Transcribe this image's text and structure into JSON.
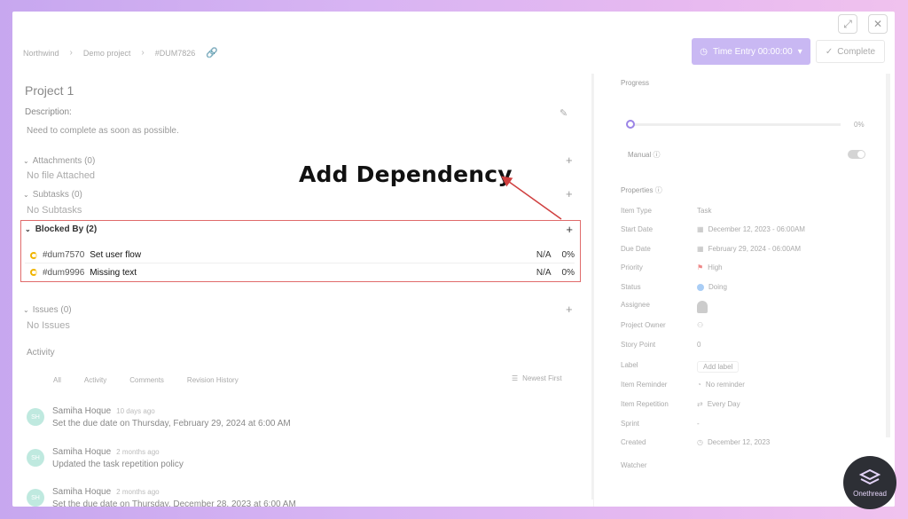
{
  "window": {
    "maximize_glyph": "⤢",
    "close_glyph": "✕"
  },
  "breadcrumb": [
    "Northwind",
    "Demo project",
    "#DUM7826"
  ],
  "header": {
    "time_entry": "Time Entry 00:00:00",
    "complete": "Complete"
  },
  "task": {
    "title": "Project 1",
    "description_label": "Description:",
    "description": "Need to complete as soon as possible."
  },
  "sections": {
    "attachments": {
      "label": "Attachments (0)",
      "empty": "No file Attached"
    },
    "subtasks": {
      "label": "Subtasks (0)",
      "empty": "No Subtasks"
    },
    "blocked_by": {
      "label": "Blocked By (2)",
      "items": [
        {
          "id": "#dum7570",
          "title": "Set user flow",
          "value": "N/A",
          "percent": "0%"
        },
        {
          "id": "#dum9996",
          "title": "Missing text",
          "value": "N/A",
          "percent": "0%"
        }
      ]
    },
    "issues": {
      "label": "Issues (0)",
      "empty": "No Issues"
    }
  },
  "activity": {
    "title": "Activity",
    "tabs": [
      "All",
      "Activity",
      "Comments",
      "Revision History"
    ],
    "sort": "Newest First",
    "items": [
      {
        "user": "Samiha Hoque",
        "time": "10 days ago",
        "text": "Set the due date on Thursday, February 29, 2024 at 6:00 AM"
      },
      {
        "user": "Samiha Hoque",
        "time": "2 months ago",
        "text": "Updated the task repetition policy"
      },
      {
        "user": "Samiha Hoque",
        "time": "2 months ago",
        "text": "Set the due date on Thursday, December 28, 2023 at 6:00 AM"
      }
    ]
  },
  "progress": {
    "label": "Progress",
    "value": "0%",
    "manual_label": "Manual"
  },
  "properties": {
    "label": "Properties",
    "rows": [
      {
        "key": "Item Type",
        "value": "Task"
      },
      {
        "key": "Start Date",
        "value": "December 12, 2023 - 06:00AM"
      },
      {
        "key": "Due Date",
        "value": "February 29, 2024 - 06:00AM"
      },
      {
        "key": "Priority",
        "value": "High"
      },
      {
        "key": "Status",
        "value": "Doing"
      },
      {
        "key": "Assignee",
        "value": ""
      },
      {
        "key": "Project Owner",
        "value": ""
      },
      {
        "key": "Story Point",
        "value": "0"
      },
      {
        "key": "Label",
        "value": "Add label"
      },
      {
        "key": "Item Reminder",
        "value": "No reminder"
      },
      {
        "key": "Item Repetition",
        "value": "Every Day"
      },
      {
        "key": "Sprint",
        "value": "-"
      },
      {
        "key": "Created",
        "value": "December 12, 2023"
      },
      {
        "key": "Watcher",
        "value": ""
      }
    ]
  },
  "annotation": {
    "text": "Add Dependency",
    "color": "#d04040",
    "highlight_color": "#e06b6b"
  },
  "brand": {
    "name": "Onethread"
  }
}
